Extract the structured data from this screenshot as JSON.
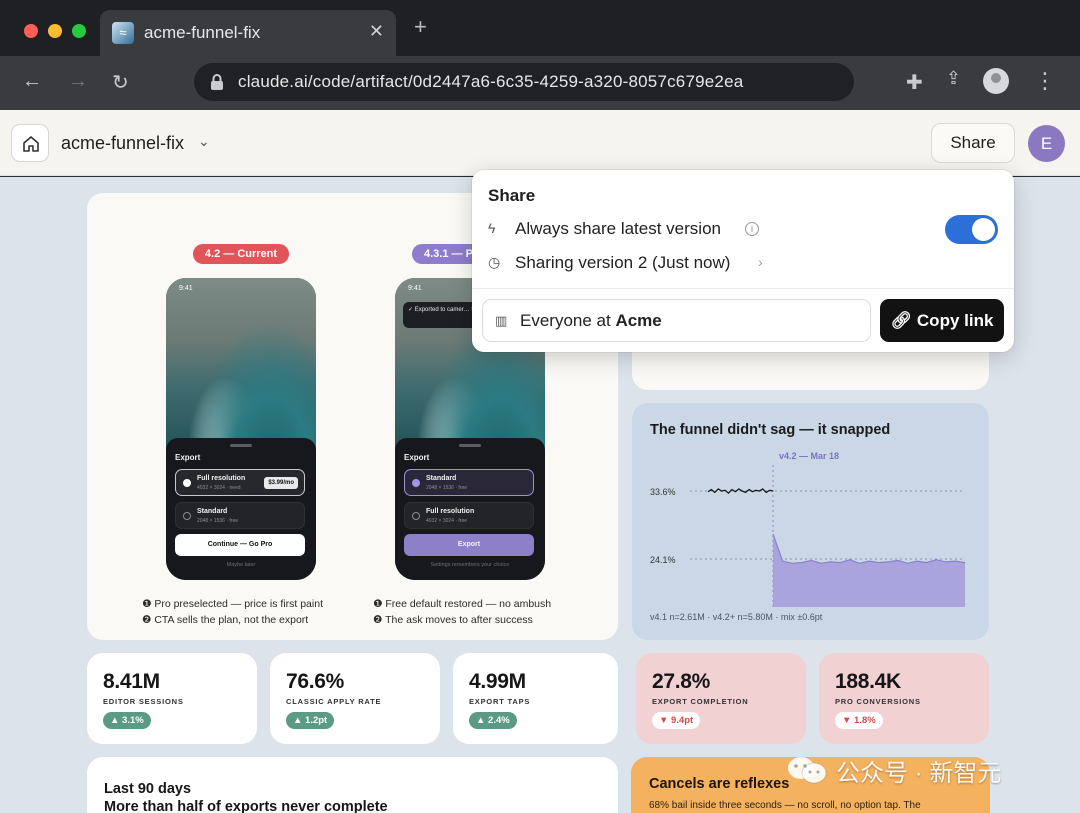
{
  "browser": {
    "tab_title": "acme-funnel-fix",
    "tab_close": "✕",
    "new_tab": "+",
    "url": "claude.ai/code/artifact/0d2447a6-6c35-4259-a320-8057c679e2ea"
  },
  "app_header": {
    "project_title": "acme-funnel-fix",
    "share_label": "Share",
    "avatar_initial": "E"
  },
  "share_popover": {
    "title": "Share",
    "always_share_label": "Always share latest version",
    "always_share_enabled": true,
    "version_label": "Sharing version 2 (Just now)",
    "audience_prefix": "Everyone at ",
    "audience_org": "Acme",
    "copy_link_label": "Copy link"
  },
  "hero": {
    "current_pill": "4.2 — Current",
    "proposed_pill": "4.3.1 — P",
    "phones": [
      {
        "time": "9:41",
        "sheet_title": "Export",
        "options": [
          {
            "name": "Full resolution",
            "sub": "4032 × 3024 · need",
            "price": "$3.99/mo",
            "selected": true
          },
          {
            "name": "Standard",
            "sub": "2048 × 1536 · free",
            "price": "",
            "selected": false
          }
        ],
        "cta": "Continue — Go Pro",
        "footer": "Maybe later",
        "notes": [
          "❶ Pro preselected — price is first paint",
          "❷ CTA sells the plan, not the export"
        ]
      },
      {
        "time": "9:41",
        "toast": "✓ Exported to camer… full res? Try Pro free",
        "sheet_title": "Export",
        "options": [
          {
            "name": "Standard",
            "sub": "2048 × 1536 · free",
            "price": "",
            "selected": true
          },
          {
            "name": "Full resolution",
            "sub": "4032 × 3024 · free",
            "price": "",
            "selected": false
          }
        ],
        "cta": "Export",
        "footer": "Settings remembers your choice",
        "notes": [
          "❶ Free default restored — no ambush",
          "❷ The ask moves to after success"
        ]
      }
    ]
  },
  "chart_card": {
    "title": "The funnel didn't sag — it snapped",
    "footnote": "v4.1 n=2.61M · v4.2+ n=5.80M · mix ±0.6pt"
  },
  "chart_data": {
    "type": "area",
    "title": "The funnel didn't sag — it snapped",
    "annotation": "v4.2 — Mar 18",
    "ytick_labels": [
      "33.6%",
      "24.1%"
    ],
    "series": [
      {
        "values": [
          33.5,
          33.8,
          33.4,
          33.9,
          33.6,
          33.7,
          33.3,
          33.8,
          33.5,
          33.9,
          33.6,
          33.4,
          33.8,
          33.5,
          33.7,
          33.6,
          33.9,
          33.4,
          33.7,
          33.6
        ]
      },
      {
        "values": [
          27.6,
          23.8,
          23.5,
          23.6,
          23.9,
          23.5,
          23.7,
          23.6,
          24.0,
          23.5,
          23.8,
          23.6,
          23.7,
          23.9,
          23.5,
          23.8,
          23.6,
          24.0,
          23.7,
          23.8,
          23.6
        ]
      }
    ],
    "colors": {
      "before": "#1a1a1a",
      "after": "#9a91d4",
      "fill": "#a39bd9",
      "annotation": "#7b72c4"
    }
  },
  "kpis": [
    {
      "value": "8.41M",
      "label": "EDITOR SESSIONS",
      "delta": "▲ 3.1%",
      "trend": "up"
    },
    {
      "value": "76.6%",
      "label": "CLASSIC APPLY RATE",
      "delta": "▲ 1.2pt",
      "trend": "up"
    },
    {
      "value": "4.99M",
      "label": "EXPORT TAPS",
      "delta": "▲ 2.4%",
      "trend": "up"
    },
    {
      "value": "27.8%",
      "label": "EXPORT COMPLETION",
      "delta": "▼ 9.4pt",
      "trend": "down"
    },
    {
      "value": "188.4K",
      "label": "PRO CONVERSIONS",
      "delta": "▼ 1.8%",
      "trend": "down"
    }
  ],
  "bottom_left": {
    "line1": "Last 90 days",
    "line2": "More than half of exports never complete"
  },
  "bottom_right": {
    "title": "Cancels are reflexes",
    "text": "68% bail inside three seconds — no scroll, no option tap. The"
  },
  "watermark": {
    "text": "公众号 · 新智元"
  }
}
